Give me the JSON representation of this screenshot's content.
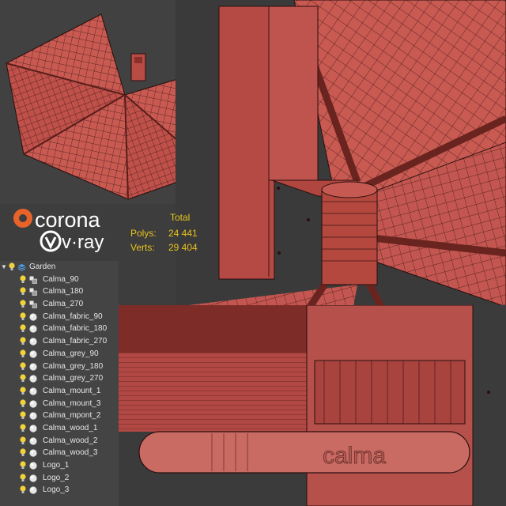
{
  "logos": {
    "corona": "corona",
    "vray": "v·ray"
  },
  "stats": {
    "header": "Total",
    "rows": [
      {
        "label": "Polys:",
        "value": "24 441"
      },
      {
        "label": "Verts:",
        "value": "29 404"
      }
    ]
  },
  "scene_tree": {
    "root": "Garden",
    "items": [
      {
        "label": "Calma_90",
        "icon": "group-icon"
      },
      {
        "label": "Calma_180",
        "icon": "group-icon"
      },
      {
        "label": "Calma_270",
        "icon": "group-icon"
      },
      {
        "label": "Calma_fabric_90",
        "icon": "sphere-icon"
      },
      {
        "label": "Calma_fabric_180",
        "icon": "sphere-icon"
      },
      {
        "label": "Calma_fabric_270",
        "icon": "sphere-icon"
      },
      {
        "label": "Calma_grey_90",
        "icon": "sphere-icon"
      },
      {
        "label": "Calma_grey_180",
        "icon": "sphere-icon"
      },
      {
        "label": "Calma_grey_270",
        "icon": "sphere-icon"
      },
      {
        "label": "Calma_mount_1",
        "icon": "sphere-icon"
      },
      {
        "label": "Calma_mount_3",
        "icon": "sphere-icon"
      },
      {
        "label": "Calma_mpont_2",
        "icon": "sphere-icon"
      },
      {
        "label": "Calma_wood_1",
        "icon": "sphere-icon"
      },
      {
        "label": "Calma_wood_2",
        "icon": "sphere-icon"
      },
      {
        "label": "Calma_wood_3",
        "icon": "sphere-icon"
      },
      {
        "label": "Logo_1",
        "icon": "sphere-icon"
      },
      {
        "label": "Logo_2",
        "icon": "sphere-icon"
      },
      {
        "label": "Logo_3",
        "icon": "sphere-icon"
      }
    ]
  },
  "base_engraving": "calma",
  "colors": {
    "model_red": "#c85a52",
    "model_dark": "#7a2a26",
    "wire": "#3a1412",
    "stats_yellow": "#e8c21c",
    "corona_orange": "#e8632a"
  }
}
